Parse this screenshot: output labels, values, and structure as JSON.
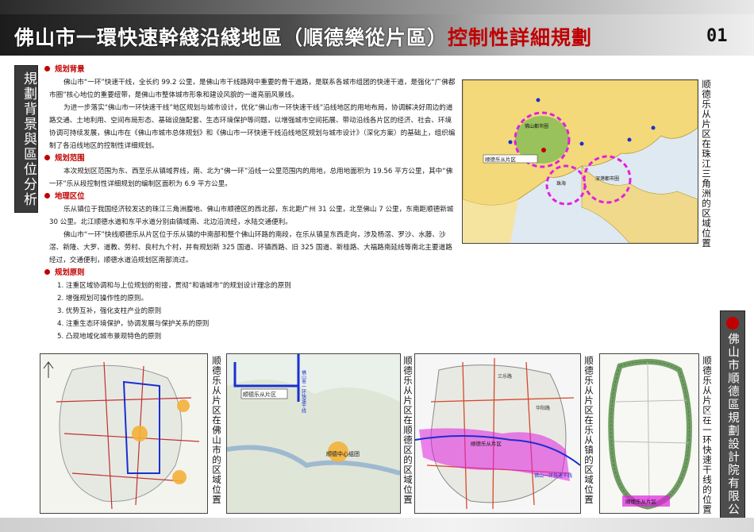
{
  "header": {
    "title_main": "佛山市一環快速幹綫沿綫地區（順德樂從片區）",
    "title_accent": "控制性詳細規劃",
    "page_number": "01"
  },
  "side_label": "規劃背景與區位分析",
  "sections": [
    {
      "title": "规划背景",
      "paragraphs": [
        "佛山市“一环”快速干线，全长约 99.2 公里，是佛山市干线路网中重要的骨干道路，是联系各城市组团的快速干道，是强化“广佛都市圈”核心地位的重要纽带，是佛山市整体城市形象和建设风貌的一道亮丽风景线。",
        "为进一步落实“佛山市一环快速干线”地区规划与城市设计，优化“佛山市一环快速干线”沿线地区的用地布局，协调解决好周边的道路交通、土地利用、空间布局形态、基础设施配套、生态环境保护等问题，以增强城市空间拓展、带动沿线各片区的经济、社会、环境协调可持续发展，佛山市在《佛山市城市总体规划》和《佛山市一环快速干线沿线地区规划与城市设计》（深化方案）的基础上，组织编制了各沿线地区的控制性详细规划。"
      ]
    },
    {
      "title": "规划范围",
      "paragraphs": [
        "本次规划区范围为东、西至乐从镇域界线，南、北为“佛一环”沿线一公里范围内的用地，总用地面积为 19.56 平方公里，其中“佛一环”乐从段控制性详细规划的编制区面积为 6.9 平方公里。"
      ]
    },
    {
      "title": "地理区位",
      "paragraphs": [
        "乐从镇位于我国经济较发达的珠江三角洲腹地、佛山市顺德区的西北部，东北距广州 31 公里，北至佛山 7 公里，东南距顺德新城 30 公里。北江顺德水道和东平水道分别由镇域南、北边沿流经，水陆交通便利。",
        "佛山市“一环”快线顺德乐从片区位于乐从镇的中南部和整个佛山环路的南段，在乐从镇呈东西走向，涉及杨滘、罗沙、水藤、沙滘、新隆、大罗、道教、劳村、良村九个村，并有规划新 325 国道、环镇西路、旧 325 国道、新桂路、大福路南延线等南北主要道路经过，交通便利，顺德水道沿规划区南部流过。"
      ]
    },
    {
      "title": "规划原则",
      "items": [
        "1. 注重区域协调和与上位规划的衔接，贯彻“和谐城市”的规划设计理念的原则",
        "2. 增强规划可操作性的原则。",
        "3. 优势互补，强化支柱产业的原则",
        "4. 注重生态环境保护，协调发展与保护关系的原则",
        "5. 凸现地域化城市景观特色的原则"
      ]
    }
  ],
  "maps": {
    "prd": {
      "caption": "顺德乐从片区在珠江三角洲的区域位置",
      "labels": {
        "foshan": "佛山都市圈",
        "lecong": "顺德乐从片区",
        "zhuhai": "珠海",
        "shenzhen": "深港都市圈",
        "huanmo": "佛山一环快速干线"
      }
    },
    "foshan": {
      "caption": "顺德乐从片区在佛山市的区域位置"
    },
    "shunde": {
      "caption": "顺德乐从片区在顺德区的区域位置",
      "labels": {
        "ring": "佛山市一环快速干线",
        "lecong": "顺德乐从片区",
        "center": "顺德中心组团"
      }
    },
    "town": {
      "caption": "顺德乐从片区在乐从镇的区域位置",
      "labels": {
        "lecong": "顺德乐从片区",
        "ring": "佛山一环快速干线",
        "road_a": "三乐路",
        "road_b": "华阳路"
      }
    },
    "ring": {
      "caption": "顺德乐从片区在一环快速干线的位置",
      "labels": {
        "lecong": "顺德乐从片区"
      }
    }
  },
  "company": "佛山市順德區規劃設計院有限公司",
  "colors": {
    "accent": "#c00000",
    "magenta": "#e020e0",
    "blue": "#1a2fd0",
    "orange": "#f3b13a"
  }
}
